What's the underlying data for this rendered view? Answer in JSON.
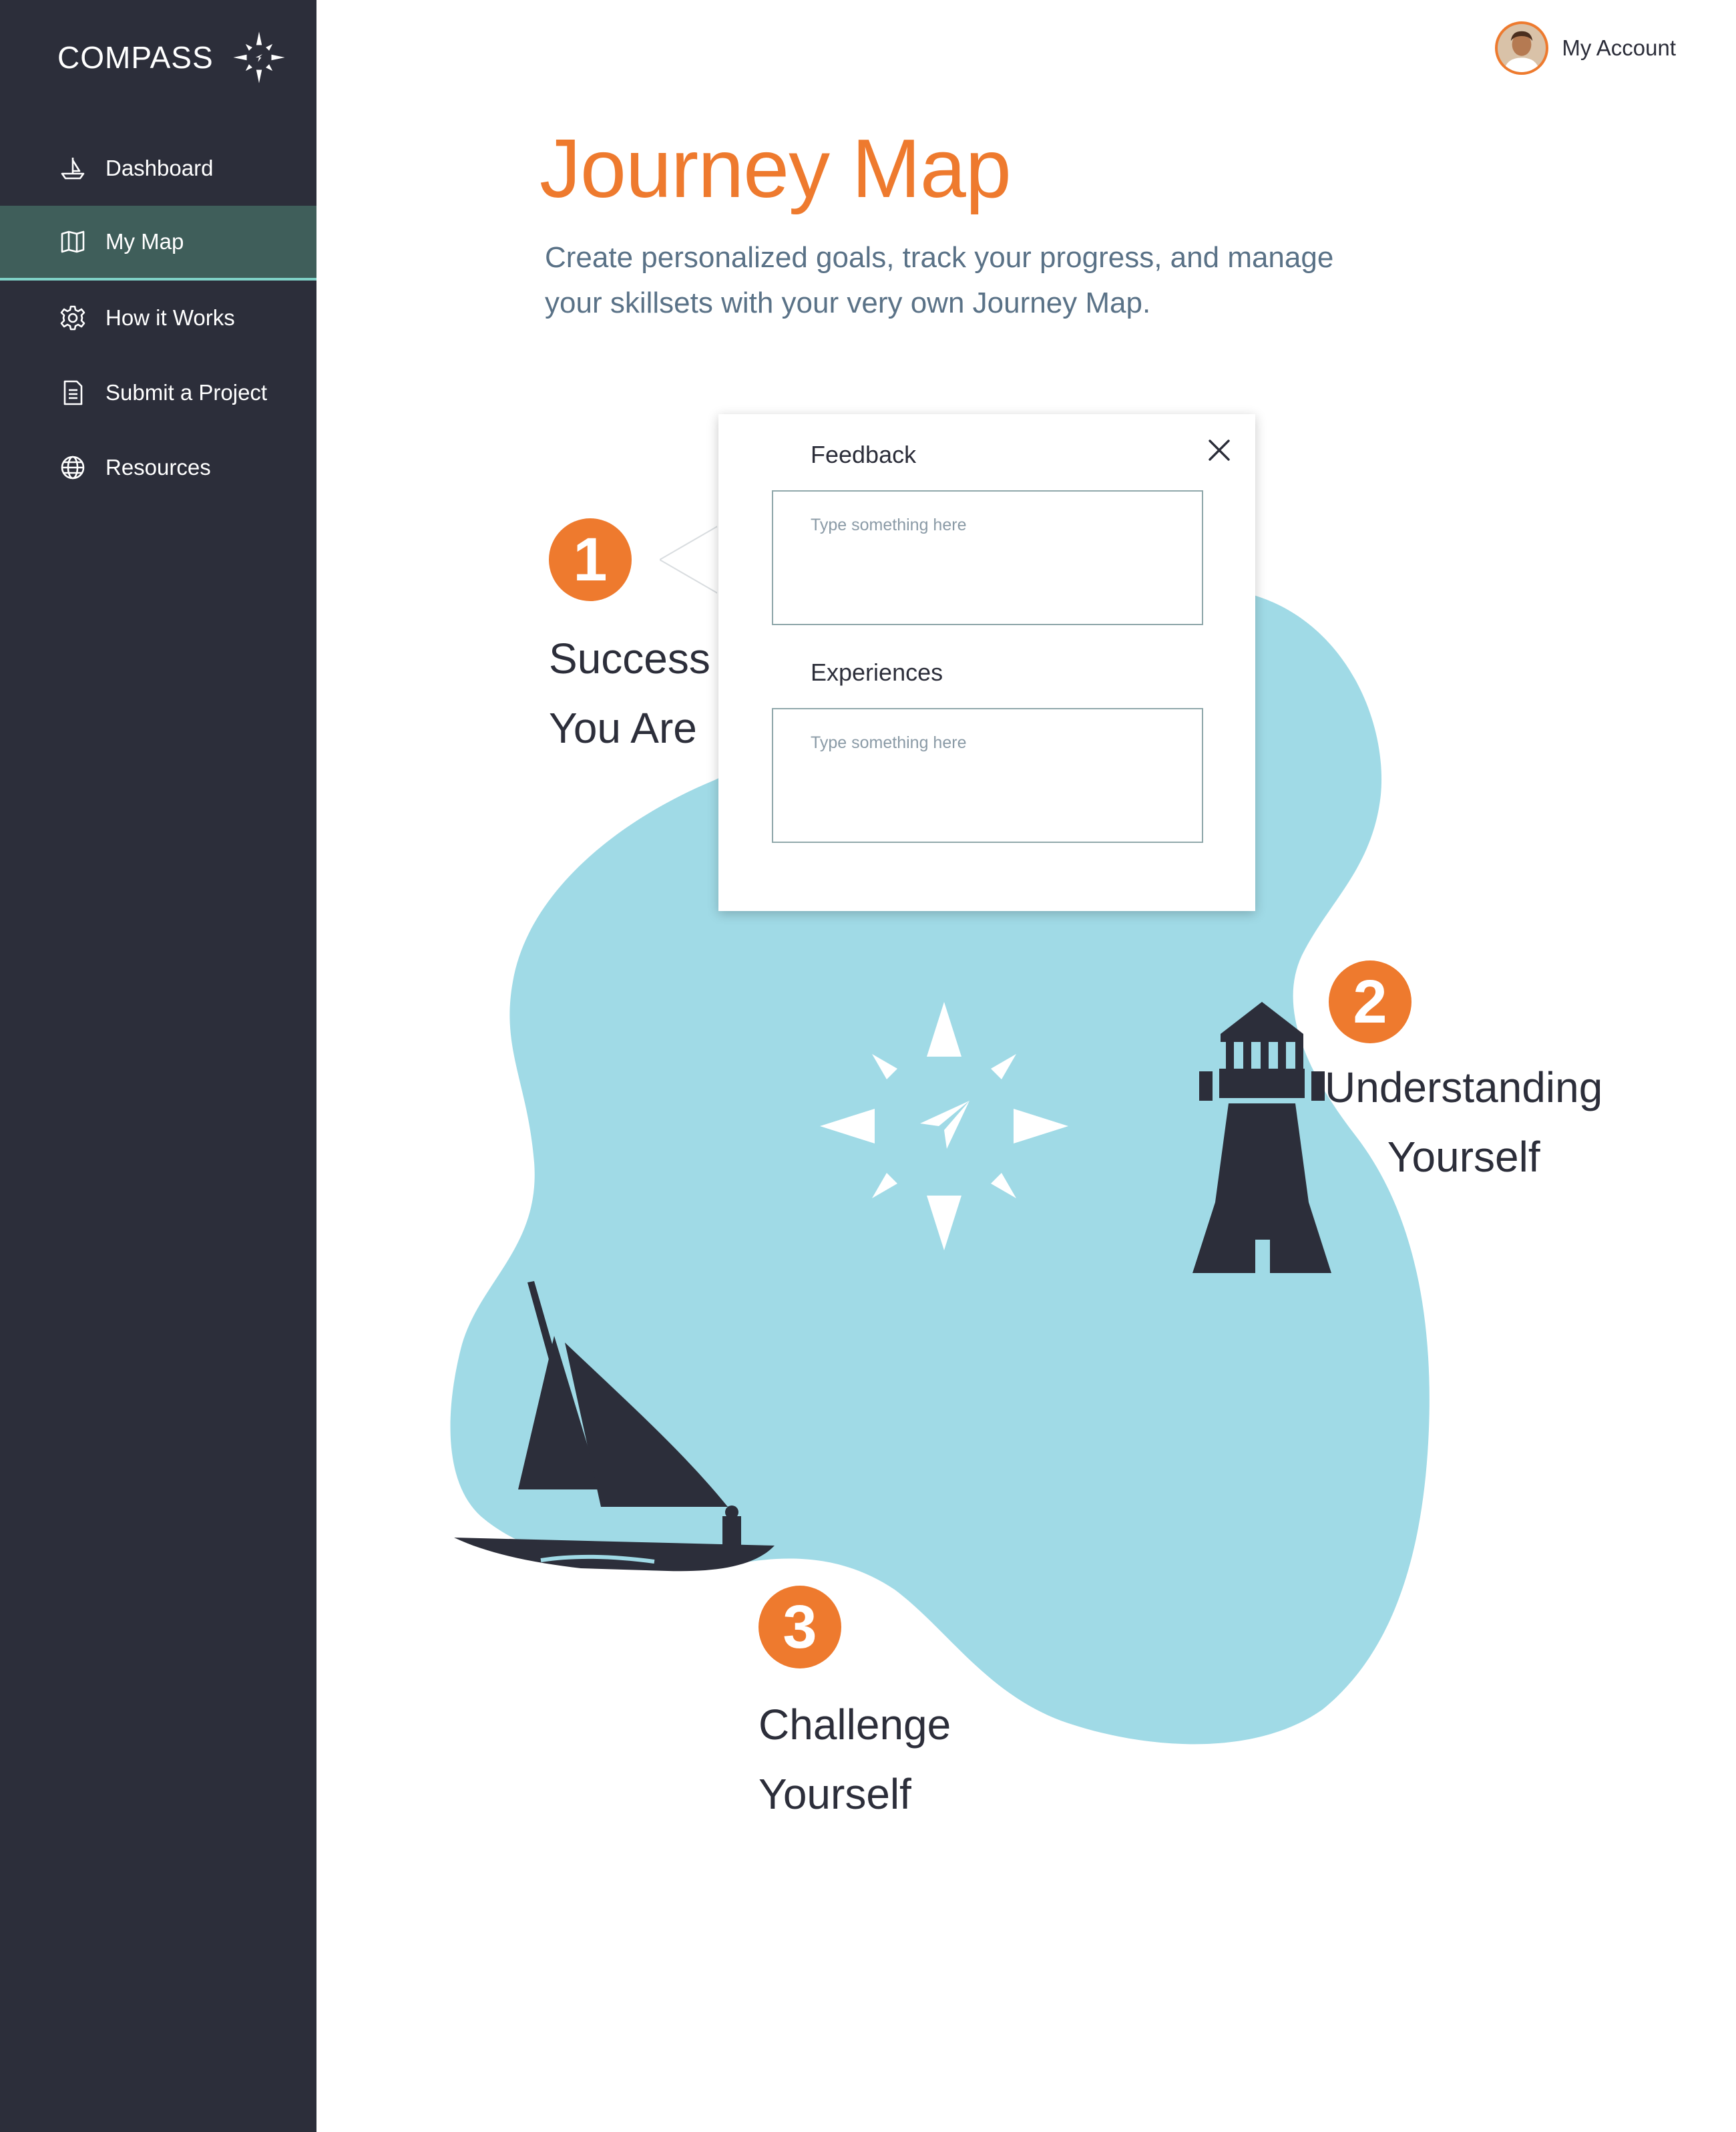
{
  "brand": {
    "name": "COMPASS"
  },
  "sidebar": {
    "items": [
      {
        "label": "Dashboard",
        "icon": "boat-icon"
      },
      {
        "label": "My Map",
        "icon": "map-icon",
        "active": true
      },
      {
        "label": "How it Works",
        "icon": "gear-icon"
      },
      {
        "label": "Submit a Project",
        "icon": "document-icon"
      },
      {
        "label": "Resources",
        "icon": "globe-icon"
      }
    ]
  },
  "account": {
    "label": "My Account"
  },
  "header": {
    "title": "Journey Map",
    "subtitle": "Create personalized goals, track your progress, and manage your skillsets with your very own Journey Map."
  },
  "steps": [
    {
      "number": "1",
      "line1": "Success W",
      "line2": "You Are"
    },
    {
      "number": "2",
      "line1": "Understanding",
      "line2": "Yourself"
    },
    {
      "number": "3",
      "line1": "Challenge",
      "line2": "Yourself"
    }
  ],
  "popup": {
    "feedback_label": "Feedback",
    "feedback_placeholder": "Type something here",
    "experiences_label": "Experiences",
    "experiences_placeholder": "Type something here"
  },
  "colors": {
    "sidebar": "#2c2e3a",
    "accent": "#ee7a2e",
    "active_nav": "#3f5e5a",
    "active_border": "#7fd2c7",
    "island": "#a0dae6",
    "subtitle": "#5a7287"
  }
}
